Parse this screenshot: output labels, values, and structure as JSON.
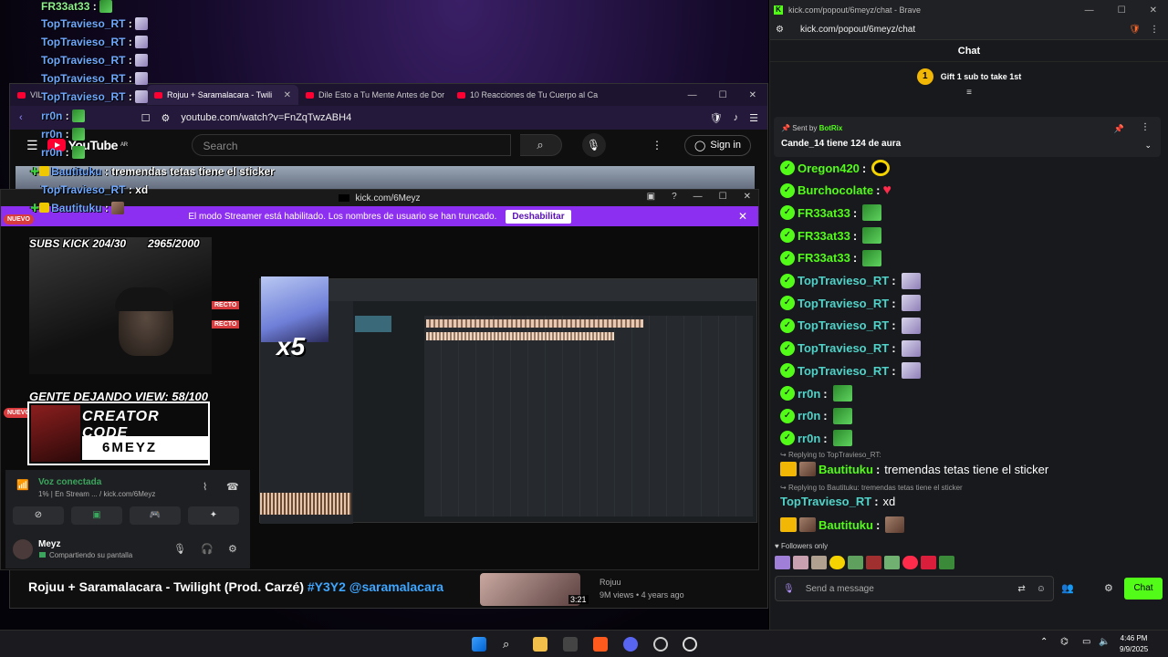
{
  "overlay_chat": [
    {
      "name": "FR33at33",
      "sep": " :",
      "msg": "",
      "emote": "w",
      "color": "green"
    },
    {
      "name": "TopTravieso_RT",
      "sep": " :",
      "msg": "",
      "emote": "girl",
      "color": "blue"
    },
    {
      "name": "TopTravieso_RT",
      "sep": " :",
      "msg": "",
      "emote": "girl",
      "color": "blue"
    },
    {
      "name": "TopTravieso_RT",
      "sep": " :",
      "msg": "",
      "emote": "girl",
      "color": "blue"
    },
    {
      "name": "TopTravieso_RT",
      "sep": " :",
      "msg": "",
      "emote": "girl",
      "color": "blue"
    },
    {
      "name": "TopTravieso_RT",
      "sep": " :",
      "msg": "",
      "emote": "girl",
      "color": "blue"
    },
    {
      "name": "rr0n",
      "sep": " :",
      "msg": "",
      "emote": "w",
      "color": "blue"
    },
    {
      "name": "rr0n",
      "sep": " :",
      "msg": "",
      "emote": "w",
      "color": "blue"
    },
    {
      "name": "rr0n",
      "sep": " :",
      "msg": "",
      "emote": "w",
      "color": "blue"
    },
    {
      "name": "Bautituku",
      "sep": " :",
      "msg": "tremendas tetas tiene el sticker",
      "emote": "",
      "color": "blue"
    },
    {
      "name": "TopTravieso_RT",
      "sep": " :",
      "msg": "xd",
      "emote": "",
      "color": "blue"
    },
    {
      "name": "Bautituku",
      "sep": " :",
      "msg": "",
      "emote": "photo",
      "color": "blue"
    }
  ],
  "youtube": {
    "tabs": [
      {
        "label": "VIL"
      },
      {
        "label": "Rojuu + Saramalacara - Twili"
      },
      {
        "label": "Dile Esto a Tu Mente Antes de Dor"
      },
      {
        "label": "10 Reacciones de Tu Cuerpo al Ca"
      }
    ],
    "url": "youtube.com/watch?v=FnZqTwzABH4",
    "logo": "YouTube",
    "logo_region": "AR",
    "search_placeholder": "Search",
    "sign_in": "Sign in",
    "video_title": "Rojuu + Saramalacara - Twilight (Prod. Carzé)",
    "video_tags": "#Y3Y2 @saramalacara",
    "rec_channel": "Rojuu",
    "rec_views": "9M views • 4 years ago",
    "rec_duration": "3:21"
  },
  "kick_stream": {
    "window_title": "kick.com/6Meyz",
    "banner_text": "El modo Streamer está habilitado. Los nombres de usuario se han truncado.",
    "banner_button": "Deshabilitar",
    "subs_goal": "SUBS KICK 204/30",
    "views_goal": "2965/2000",
    "people_view": "GENTE DEJANDO VIEW: 58/100",
    "creator_code_label": "CREATOR CODE",
    "creator_code": "6MEYZ",
    "multiplier": "x5",
    "nuevo": "NUEVO",
    "directo": "RECTO"
  },
  "discord": {
    "voice_status": "Voz conectada",
    "voice_sub": "1% | En Stream ... / kick.com/6Meyz",
    "username": "Meyz",
    "user_status": "Compartiendo su pantalla"
  },
  "chat": {
    "window_title": "kick.com/popout/6meyz/chat - Brave",
    "url": "kick.com/popout/6meyz/chat",
    "header": "Chat",
    "gift_num": "1",
    "gift_text": "Gift 1 sub to take 1st",
    "pinned_sent_by": "Sent by",
    "pinned_bot": "BotRix",
    "pinned_msg": "Cande_14 tiene 124 de aura",
    "messages": [
      {
        "user": "Oregon420",
        "color": "green",
        "text": "",
        "emote": "coin"
      },
      {
        "user": "Burchocolate",
        "color": "green",
        "text": "",
        "emote": "heart"
      },
      {
        "user": "FR33at33",
        "color": "green",
        "text": "",
        "emote": "w"
      },
      {
        "user": "FR33at33",
        "color": "green",
        "text": "",
        "emote": "w"
      },
      {
        "user": "FR33at33",
        "color": "green",
        "text": "",
        "emote": "w"
      },
      {
        "user": "TopTravieso_RT",
        "color": "teal",
        "text": "",
        "emote": "girl"
      },
      {
        "user": "TopTravieso_RT",
        "color": "teal",
        "text": "",
        "emote": "girl"
      },
      {
        "user": "TopTravieso_RT",
        "color": "teal",
        "text": "",
        "emote": "girl"
      },
      {
        "user": "TopTravieso_RT",
        "color": "teal",
        "text": "",
        "emote": "girl"
      },
      {
        "user": "TopTravieso_RT",
        "color": "teal",
        "text": "",
        "emote": "girl"
      },
      {
        "user": "rr0n",
        "color": "teal",
        "text": "",
        "emote": "w"
      },
      {
        "user": "rr0n",
        "color": "teal",
        "text": "",
        "emote": "w"
      },
      {
        "user": "rr0n",
        "color": "teal",
        "text": "",
        "emote": "w"
      }
    ],
    "reply1_label": "Replying to TopTravieso_RT:",
    "reply1_user": "Bautituku",
    "reply1_text": "tremendas tetas tiene el sticker",
    "msg_after_reply1_user": "TopTravieso_RT",
    "msg_after_reply1_text": "xd",
    "reply2_label": "Replying to Bautituku: tremendas tetas tiene el sticker",
    "reply2_user": "Bautituku",
    "followers_only": "Followers only",
    "input_placeholder": "Send a message",
    "send_button": "Chat"
  },
  "taskbar": {
    "time": "4:46 PM",
    "date": "9/9/2025"
  }
}
